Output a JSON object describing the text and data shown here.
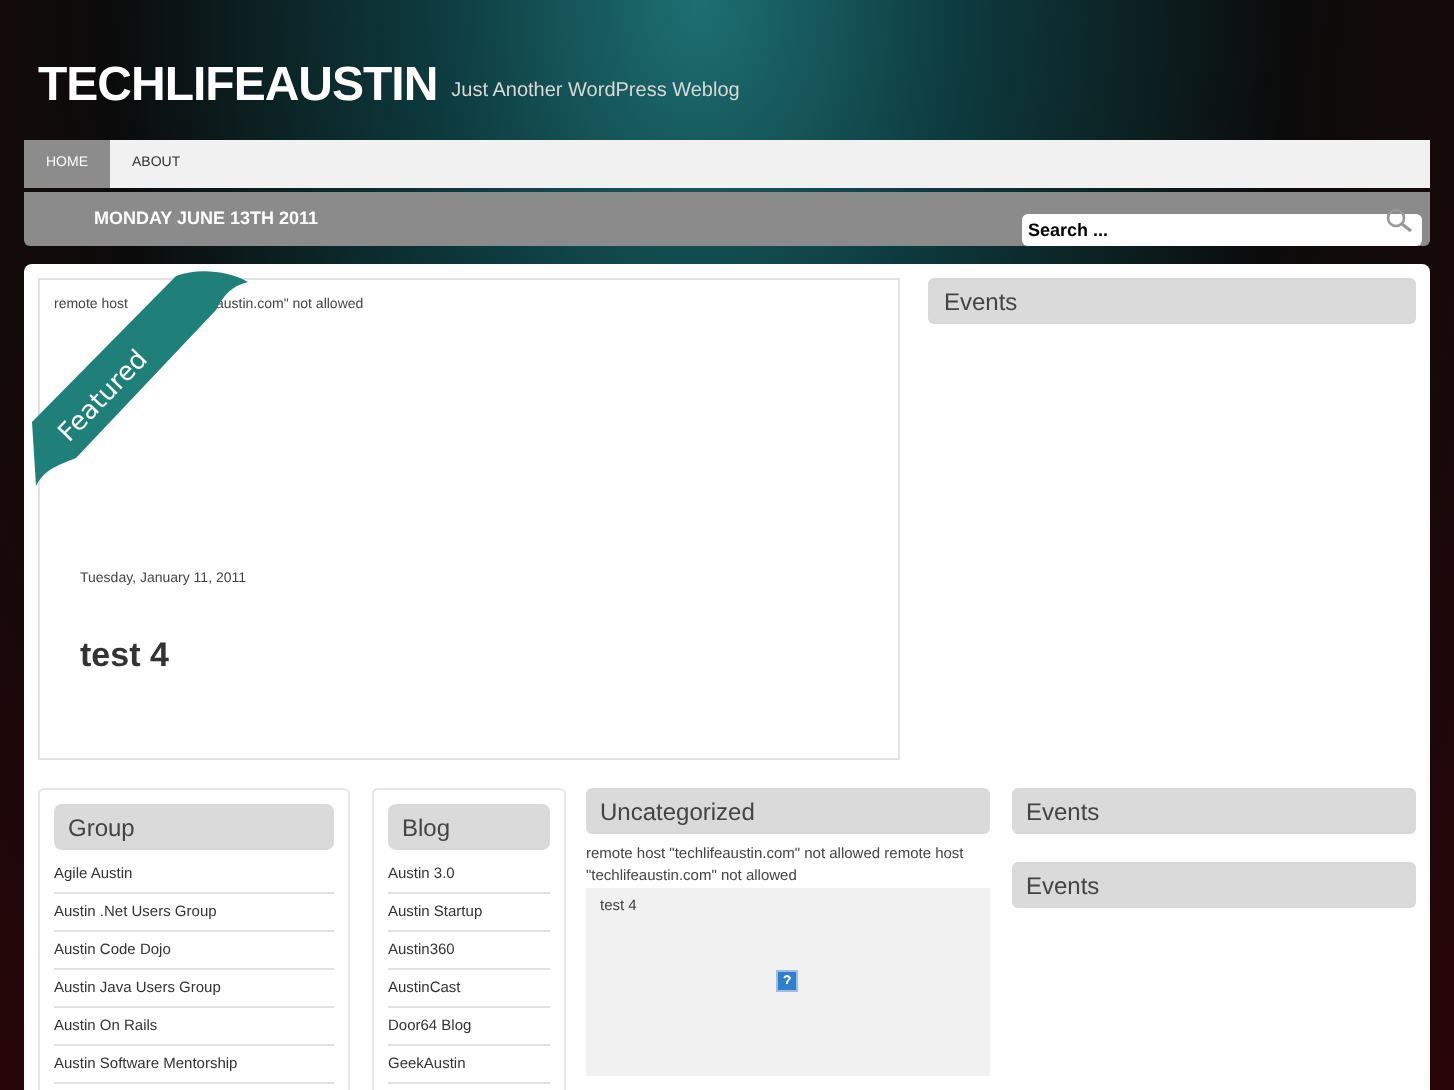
{
  "site": {
    "title": "TECHLIFEAUSTIN",
    "tagline": "Just Another WordPress Weblog"
  },
  "nav": {
    "tabs": [
      {
        "label": "HOME",
        "selected": true
      },
      {
        "label": "ABOUT",
        "selected": false
      }
    ]
  },
  "date_bar": {
    "date": "MONDAY JUNE 13TH 2011",
    "search": {
      "value": "Search ..."
    }
  },
  "featured": {
    "ribbon": "Featured",
    "error_parts": [
      "remote host",
      "austin.com\" not allowed"
    ],
    "date": "Tuesday, January 11, 2011",
    "title": "test 4"
  },
  "sidebar": {
    "heading": "Events"
  },
  "widgets": [
    {
      "heading": "Group",
      "links": [
        "Agile Austin",
        "Austin .Net Users Group",
        "Austin Code Dojo",
        "Austin Java Users Group",
        "Austin On Rails",
        "Austin Software Mentorship"
      ]
    },
    {
      "heading": "Blog",
      "links": [
        "Austin 3.0",
        "Austin Startup",
        "Austin360",
        "AustinCast",
        "Door64 Blog",
        "GeekAustin"
      ]
    }
  ],
  "uncategorized": {
    "heading": "Uncategorized",
    "error": "remote host \"techlifeaustin.com\" not allowed remote host \"techlifeaustin.com\" not allowed",
    "post_title": "test 4"
  },
  "events_widgets": [
    {
      "heading": "Events"
    },
    {
      "heading": "Events"
    }
  ]
}
